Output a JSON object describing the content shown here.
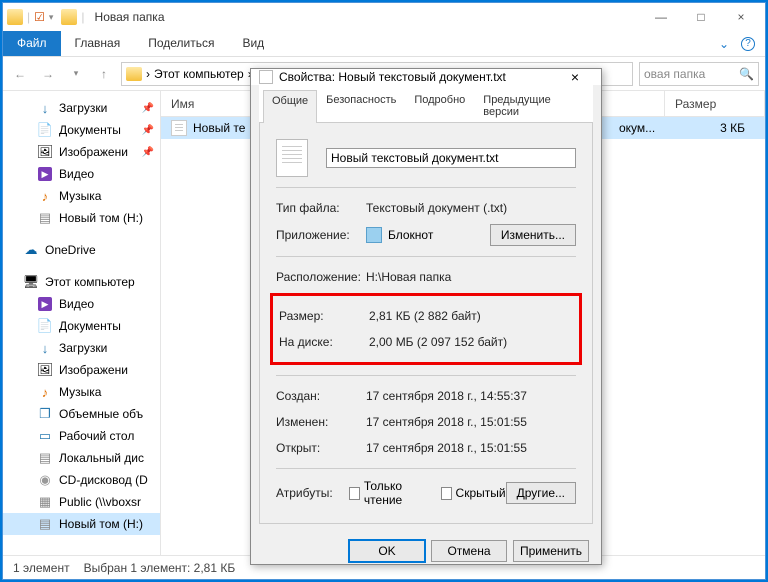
{
  "window": {
    "title": "Новая папка",
    "min": "—",
    "max": "□",
    "close": "×"
  },
  "ribbon": {
    "file": "Файл",
    "home": "Главная",
    "share": "Поделиться",
    "view": "Вид"
  },
  "address": {
    "path": "Этот компьютер",
    "chev": "›",
    "search_placeholder": "овая папка",
    "refresh": "↻"
  },
  "sidebar": {
    "downloads": "Загрузки",
    "documents": "Документы",
    "images": "Изображени",
    "video": "Видео",
    "music": "Музыка",
    "newvol": "Новый том (H:)",
    "onedrive": "OneDrive",
    "thispc": "Этот компьютер",
    "pc_video": "Видео",
    "pc_docs": "Документы",
    "pc_dl": "Загрузки",
    "pc_img": "Изображени",
    "pc_mus": "Музыка",
    "pc_obj": "Объемные объ",
    "pc_desk": "Рабочий стол",
    "pc_local": "Локальный дис",
    "pc_cd": "CD-дисковод (D",
    "pc_public": "Public (\\\\vboxsr",
    "pc_newvol": "Новый том (H:)"
  },
  "columns": {
    "name": "Имя",
    "date": "",
    "size": "Размер"
  },
  "file": {
    "name": "Новый те",
    "date": "окум...",
    "size": "3 КБ"
  },
  "status": {
    "count": "1 элемент",
    "sel": "Выбран 1 элемент: 2,81 КБ"
  },
  "dialog": {
    "title": "Свойства: Новый текстовый документ.txt",
    "close": "×",
    "tabs": {
      "general": "Общие",
      "security": "Безопасность",
      "details": "Подробно",
      "prev": "Предыдущие версии"
    },
    "filename": "Новый текстовый документ.txt",
    "type_lbl": "Тип файла:",
    "type_val": "Текстовый документ (.txt)",
    "app_lbl": "Приложение:",
    "app_val": "Блокнот",
    "change_btn": "Изменить...",
    "loc_lbl": "Расположение:",
    "loc_val": "H:\\Новая папка",
    "size_lbl": "Размер:",
    "size_val": "2,81 КБ (2 882 байт)",
    "disk_lbl": "На диске:",
    "disk_val": "2,00 МБ (2 097 152 байт)",
    "created_lbl": "Создан:",
    "created_val": "17 сентября 2018 г., 14:55:37",
    "mod_lbl": "Изменен:",
    "mod_val": "17 сентября 2018 г., 15:01:55",
    "open_lbl": "Открыт:",
    "open_val": "17 сентября 2018 г., 15:01:55",
    "attr_lbl": "Атрибуты:",
    "readonly": "Только чтение",
    "hidden": "Скрытый",
    "other_btn": "Другие...",
    "ok": "OK",
    "cancel": "Отмена",
    "apply": "Применить"
  }
}
